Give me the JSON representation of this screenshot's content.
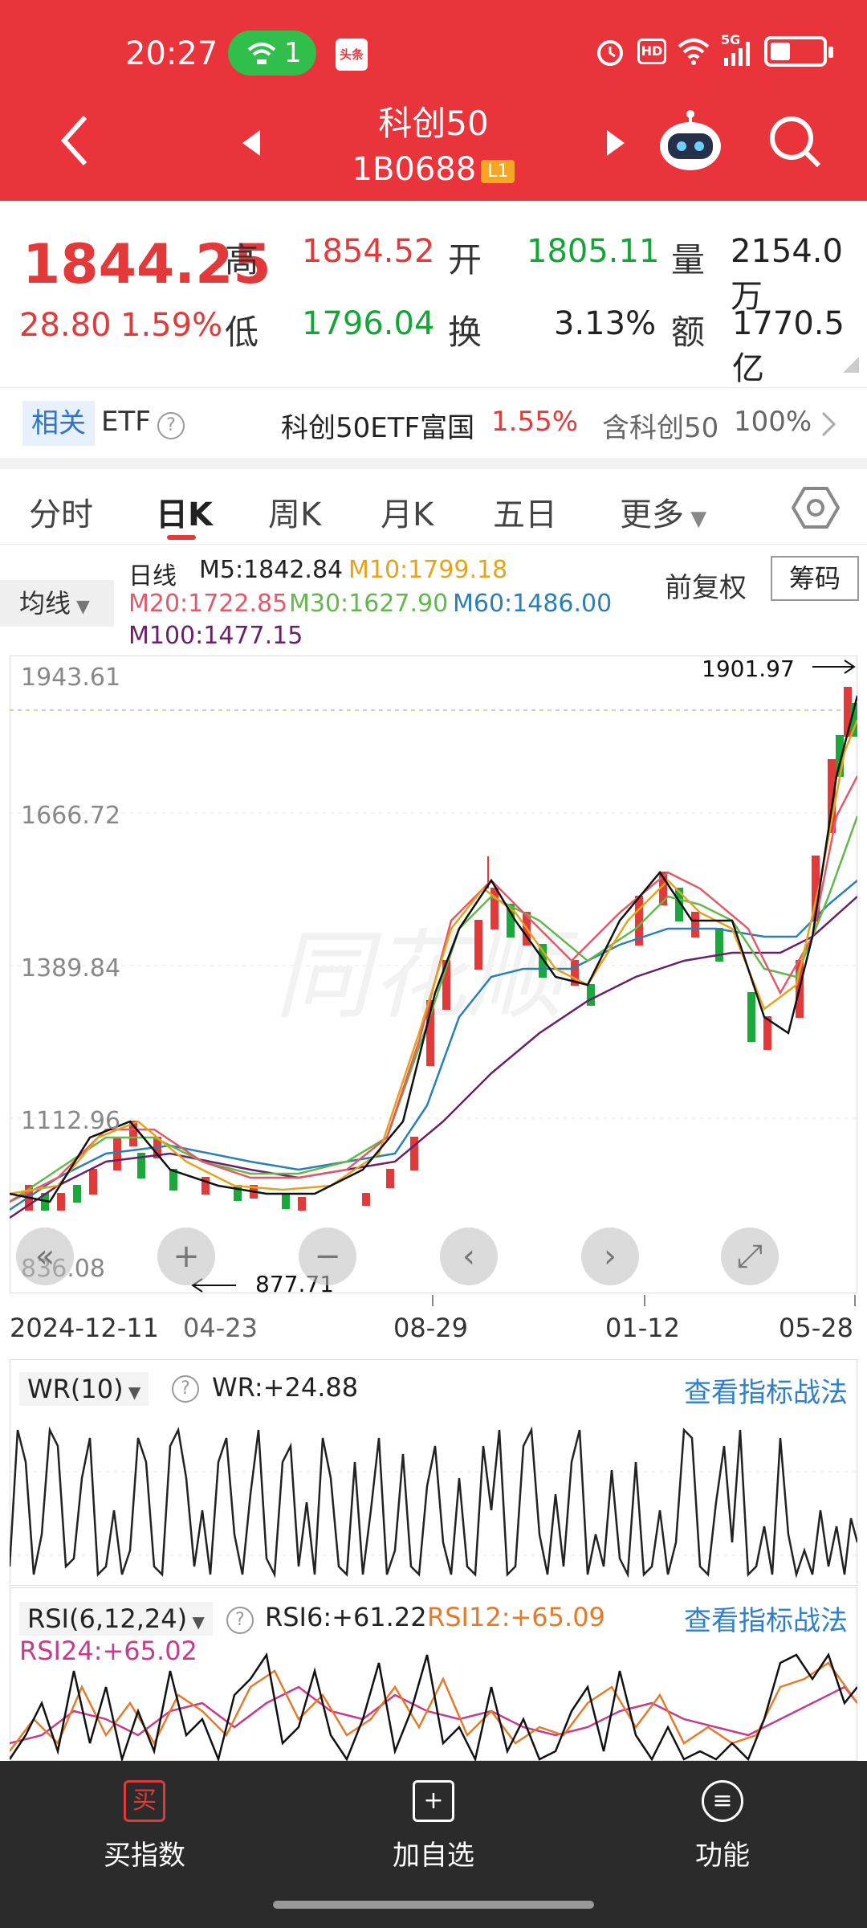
{
  "status_bar": {
    "time": "20:27",
    "wifi_count": "1",
    "toutiao_icon": "头条",
    "hd": "HD",
    "network": "5G"
  },
  "nav": {
    "title": "科创50",
    "code": "1B0688",
    "level_badge": "L1"
  },
  "quote": {
    "price": "1844.25",
    "change": "28.80",
    "change_pct": "1.59%",
    "high_label": "高",
    "high": "1854.52",
    "low_label": "低",
    "low": "1796.04",
    "open_label": "开",
    "open": "1805.11",
    "turnover_label": "换",
    "turnover": "3.13%",
    "volume_label": "量",
    "volume": "2154.0万",
    "amount_label": "额",
    "amount": "1770.5亿"
  },
  "etf": {
    "tag": "相关",
    "label": "ETF",
    "name": "科创50ETF富国",
    "pct": "1.55%",
    "contains": "含科创50",
    "contains_pct": "100%"
  },
  "tabs": [
    "分时",
    "日K",
    "周K",
    "月K",
    "五日",
    "更多"
  ],
  "active_tab": "日K",
  "ma": {
    "button": "均线",
    "period": "日线",
    "m5": "M5:1842.84",
    "m10": "M10:1799.18",
    "m20": "M20:1722.85",
    "m30": "M30:1627.90",
    "m60": "M60:1486.00",
    "m100": "M100:1477.15",
    "fuquan": "前复权",
    "chouma": "筹码"
  },
  "chart": {
    "y_labels": [
      "1943.61",
      "1666.72",
      "1389.84",
      "1112.96",
      "836.08"
    ],
    "max_marker": "1901.97",
    "min_marker": "877.71",
    "x_labels": [
      "2024-12-11",
      "04-23",
      "08-29",
      "01-12",
      "05-28"
    ]
  },
  "wr": {
    "button": "WR(10)",
    "value": "WR:+24.88",
    "link": "查看指标战法"
  },
  "rsi": {
    "button": "RSI(6,12,24)",
    "rsi6": "RSI6:+61.22",
    "rsi12": "RSI12:+65.09",
    "rsi24": "RSI24:+65.02",
    "link": "查看指标战法"
  },
  "bottom": {
    "buy": "买指数",
    "add": "加自选",
    "func": "功能",
    "buy_icon": "买"
  },
  "colors": {
    "red": "#e23a3a",
    "green": "#13a536",
    "m10": "#e8a21a",
    "m20": "#e25a6a",
    "m30": "#62b84a",
    "m60": "#2a7fb8",
    "m100": "#6a1f6a"
  }
}
